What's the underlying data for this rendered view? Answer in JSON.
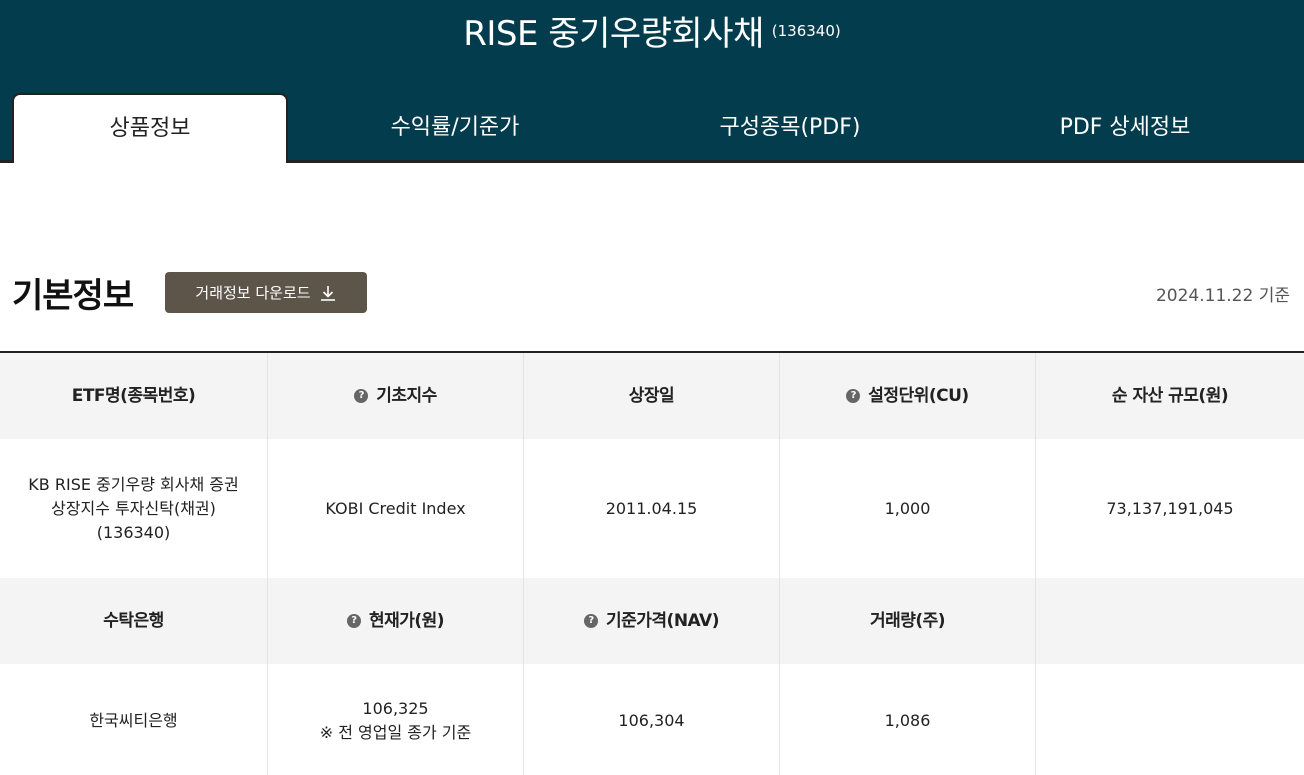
{
  "header": {
    "title": "RISE 중기우량회사채",
    "code": "(136340)",
    "tabs": [
      {
        "label": "상품정보",
        "active": true
      },
      {
        "label": "수익률/기준가",
        "active": false
      },
      {
        "label": "구성종목(PDF)",
        "active": false
      },
      {
        "label": "PDF 상세정보",
        "active": false
      }
    ]
  },
  "section": {
    "title": "기본정보",
    "download_label": "거래정보 다운로드",
    "download_icon": "download-icon",
    "as_of": "2024.11.22 기준"
  },
  "table": {
    "row1_headers": [
      "ETF명(종목번호)",
      "기초지수",
      "상장일",
      "설정단위(CU)",
      "순 자산 규모(원)"
    ],
    "row1_values": {
      "etf_name_line1": "KB RISE 중기우량 회사채 증권",
      "etf_name_line2": "상장지수 투자신탁(채권)",
      "etf_name_line3": "(136340)",
      "index": "KOBI Credit Index",
      "listing_date": "2011.04.15",
      "creation_unit": "1,000",
      "net_assets": "73,137,191,045"
    },
    "row2_headers": [
      "수탁은행",
      "현재가(원)",
      "기준가격(NAV)",
      "거래량(주)",
      ""
    ],
    "row2_values": {
      "custodian": "한국씨티은행",
      "current_price": "106,325",
      "current_price_note": "※ 전 영업일 종가 기준",
      "nav": "106,304",
      "volume": "1,086"
    },
    "help_icon": "?"
  },
  "colors": {
    "header_bg": "#033c4d",
    "button_bg": "#5d554a",
    "header_row_bg": "#f4f4f4"
  }
}
